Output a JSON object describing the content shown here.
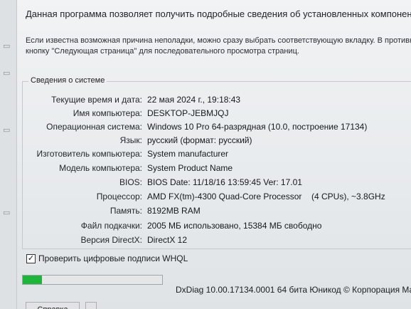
{
  "intro_text": "Данная программа позволяет получить подробные сведения об установленных компонентах и драйверах DirectX",
  "hint_lines": [
    "Если известна возможная причина неполадки, можно сразу выбрать соответствующую вкладку. В противном",
    "кнопку \"Следующая страница\" для последовательного просмотра страниц."
  ],
  "system_group": {
    "title": "Сведения о системе",
    "rows": [
      {
        "label": "Текущие время и дата:",
        "value": "22 мая 2024 г., 19:18:43"
      },
      {
        "label": "Имя компьютера:",
        "value": "DESKTOP-JEBMJQJ"
      },
      {
        "label": "Операционная система:",
        "value": "Windows 10 Pro 64-разрядная (10.0, построение 17134)"
      },
      {
        "label": "Язык:",
        "value": "русский (формат: русский)"
      },
      {
        "label": "Изготовитель компьютера:",
        "value": "System manufacturer"
      },
      {
        "label": "Модель компьютера:",
        "value": "System Product Name"
      },
      {
        "label": "BIOS:",
        "value": "BIOS Date: 11/18/16 13:59:45 Ver: 17.01"
      },
      {
        "label": "Процессор:",
        "value": "AMD FX(tm)-4300 Quad-Core Processor",
        "value2": "(4 CPUs), ~3.8GHz"
      },
      {
        "label": "Память:",
        "value": "8192MB RAM"
      },
      {
        "label": "Файл подкачки:",
        "value": "2005 МБ использовано, 15384 МБ свободно"
      },
      {
        "label": "Версия DirectX:",
        "value": "DirectX 12"
      }
    ]
  },
  "whql_checkbox": {
    "label": "Проверить цифровые подписи WHQL",
    "checked": true,
    "mark": "✓"
  },
  "progress": {
    "fraction": 0.14,
    "color": "#1fb53a"
  },
  "footer_text": "DxDiag 10.00.17134.0001 64 бита Юникод © Корпорация Майкр",
  "buttons": {
    "help": "Справка"
  }
}
